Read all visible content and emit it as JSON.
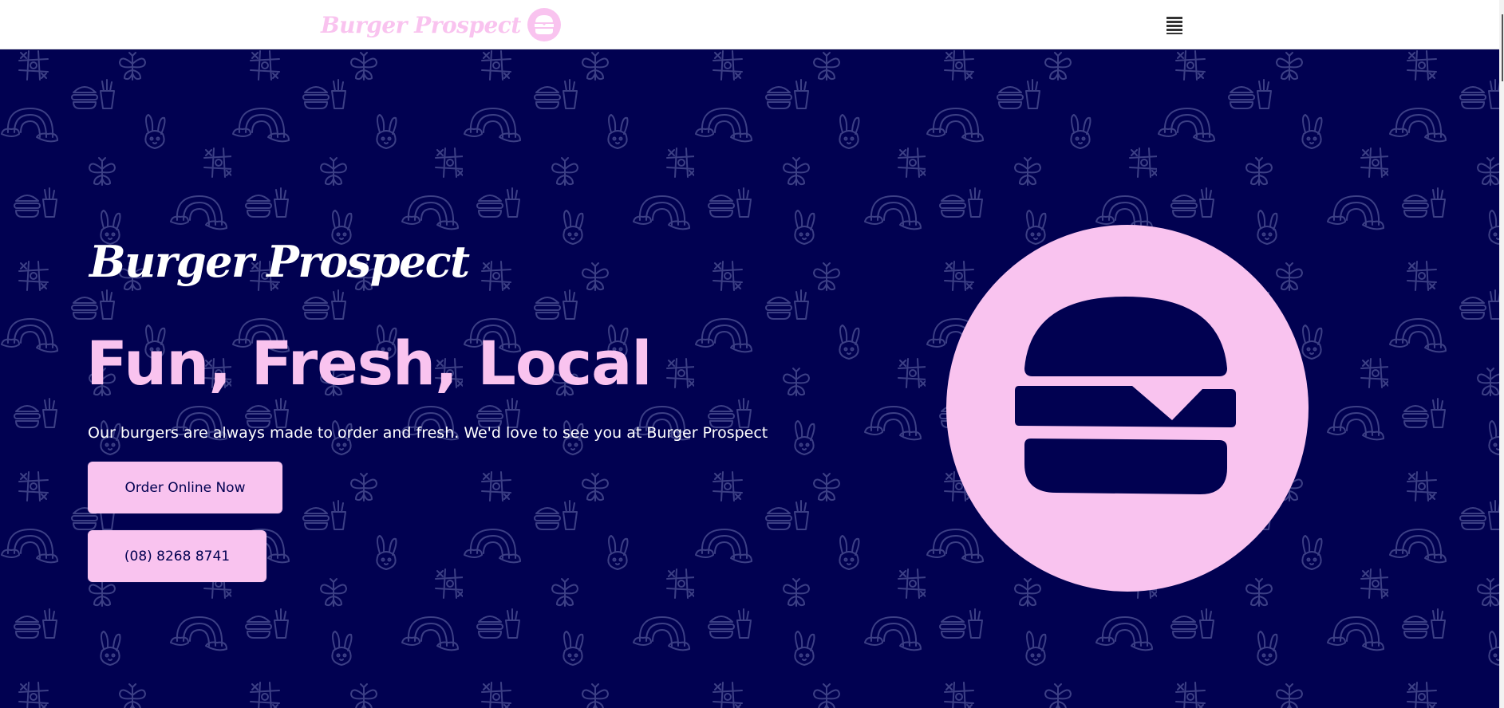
{
  "header": {
    "brand_name": "Burger Prospect",
    "logo_icon": "burger-badge-icon",
    "menu_icon": "hamburger-menu-icon"
  },
  "hero": {
    "script_title": "Burger Prospect",
    "heading": "Fun, Fresh, Local",
    "subtext": "Our burgers are always made to order and fresh. We'd love to see you at Burger Prospect",
    "order_button_label": "Order Online Now",
    "phone_button_label": "(08) 8268 8741",
    "hero_icon": "burger-icon"
  },
  "colors": {
    "navy": "#010151",
    "pink": "#f9c3ef",
    "white": "#ffffff",
    "pattern_stroke": "#3c3f85"
  }
}
